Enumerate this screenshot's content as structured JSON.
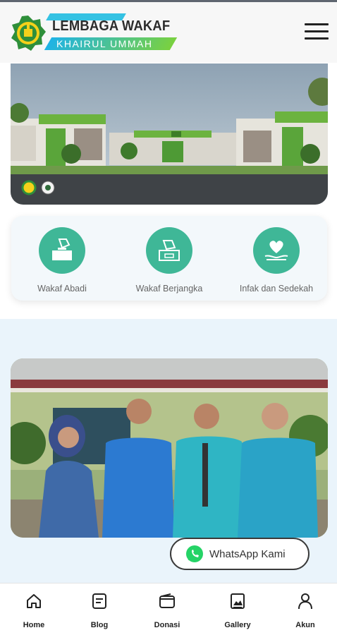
{
  "header": {
    "title": "LEMBAGA WAKAF",
    "subtitle": "KHAIRUL UMMAH"
  },
  "services": [
    {
      "label": "Wakaf Abadi",
      "icon": "donation-box-icon"
    },
    {
      "label": "Wakaf Berjangka",
      "icon": "ballot-box-icon"
    },
    {
      "label": "Infak dan Sedekah",
      "icon": "heart-hand-icon"
    }
  ],
  "whatsapp": {
    "label": "WhatsApp Kami",
    "icon": "whatsapp-icon"
  },
  "bottom_nav": [
    {
      "label": "Home",
      "icon": "home-icon"
    },
    {
      "label": "Blog",
      "icon": "blog-icon"
    },
    {
      "label": "Donasi",
      "icon": "wallet-icon"
    },
    {
      "label": "Gallery",
      "icon": "gallery-icon"
    },
    {
      "label": "Akun",
      "icon": "user-icon"
    }
  ],
  "colors": {
    "accent_green": "#3fb797",
    "brand_cyan": "#35c2e3",
    "brand_lime": "#7ad13f",
    "whatsapp_green": "#25d366"
  }
}
